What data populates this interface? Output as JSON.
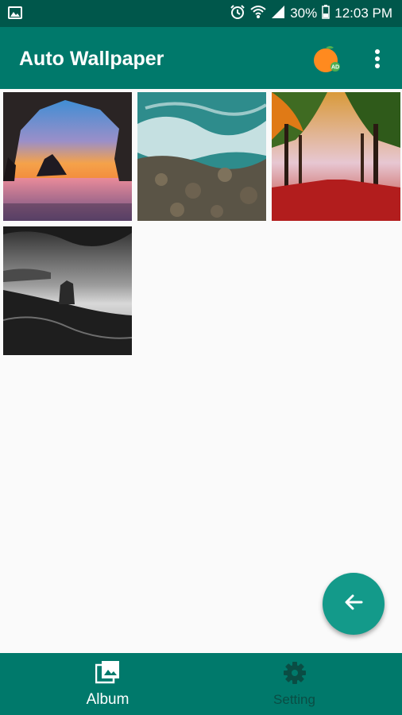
{
  "status_bar": {
    "battery": "30%",
    "time": "12:03 PM",
    "icons": [
      "gallery-icon",
      "alarm-icon",
      "wifi-icon",
      "signal-icon",
      "battery-icon"
    ]
  },
  "app_bar": {
    "title": "Auto Wallpaper",
    "icons": [
      "orange-ad-icon",
      "more-vert-icon"
    ]
  },
  "album": {
    "thumbnails": [
      "sea-cave-sunset",
      "aerial-ocean-waves",
      "autumn-tree-path",
      "black-white-sea-stack"
    ]
  },
  "fab": {
    "icon": "arrow-back-icon"
  },
  "bottom_nav": {
    "items": [
      {
        "label": "Album",
        "icon": "photo-library-icon",
        "active": true
      },
      {
        "label": "Setting",
        "icon": "gear-icon",
        "active": false
      }
    ]
  },
  "colors": {
    "status_bar": "#00574b",
    "primary": "#00796b",
    "fab": "#139a8a",
    "background": "#fafafa"
  }
}
